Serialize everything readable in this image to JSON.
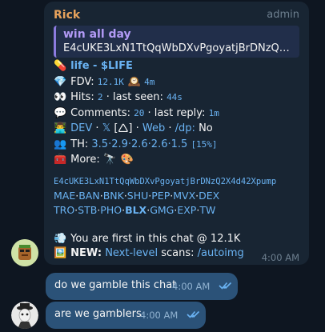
{
  "incoming": {
    "sender": "Rick",
    "role": "admin",
    "quote_title": "win all day",
    "quote_text": "E4cUKE3LxN1TtQqWbDXvPgoyatjBrDNzQ2X4d...",
    "token_line": "life - $LIFE",
    "fdv_label": "FDV:",
    "fdv_value": "12.1K",
    "fdv_age": "4m",
    "hits_label": "Hits:",
    "hits_value": "2",
    "last_seen_label": "· last seen:",
    "last_seen_value": "44s",
    "comments_label": "Comments:",
    "comments_value": "20",
    "last_reply_label": "· last reply:",
    "last_reply_value": "1m",
    "dev_links": {
      "dev": "DEV",
      "x": "𝕏",
      "x_extra": "[🛆]",
      "web": "Web",
      "dp_label": "/dp:",
      "dp_value": "No"
    },
    "th_label": "TH:",
    "th_values": "3.5·2.9·2.6·2.6·1.5",
    "th_total": "[15%]",
    "more_label": "More:",
    "contract": "E4cUKE3LxN1TtQqWbDXvPgoyatjBrDNzQ2X4d42Xpump",
    "tickers_row1": [
      "MAE",
      "BAN",
      "BNK",
      "SHU",
      "PEP",
      "MVX",
      "DEX"
    ],
    "tickers_row2": [
      "TRO",
      "STB",
      "PHO",
      "BLX",
      "GMG",
      "EXP",
      "TW"
    ],
    "first_text": "You are first in this chat @ 12.1K",
    "new_label": "NEW:",
    "new_link": "Next-level",
    "new_text": "scans:",
    "new_cmd": "/autoimg",
    "time": "4:00 AM"
  },
  "outgoing": [
    {
      "text": "do we gamble this chat",
      "time": "4:00 AM"
    },
    {
      "text": "are we gamblers",
      "time": "4:00 AM"
    }
  ],
  "colors": {
    "background": "#0e1621",
    "incoming_bubble": "#182533",
    "outgoing_bubble": "#2b5278",
    "link": "#6ab3f3",
    "sender": "#e8a35c"
  }
}
